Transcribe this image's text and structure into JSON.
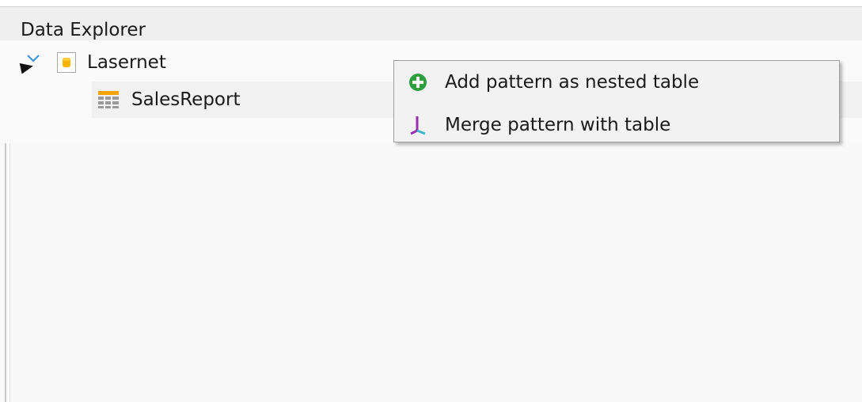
{
  "panel": {
    "title": "Data Explorer"
  },
  "tree": {
    "root": {
      "label": "Lasernet",
      "icon": "database-icon"
    },
    "child": {
      "label": "SalesReport",
      "icon": "table-icon"
    }
  },
  "context_menu": {
    "items": [
      {
        "label": "Add pattern as nested table",
        "icon": "add-circle-icon",
        "color": "#2e9e3f"
      },
      {
        "label": "Merge pattern with table",
        "icon": "merge-icon",
        "color": "#9b2fae"
      }
    ]
  },
  "colors": {
    "db_icon": "#f5b400",
    "table_icon_header": "#f5a300",
    "merge_accent": "#3fb7c9"
  }
}
